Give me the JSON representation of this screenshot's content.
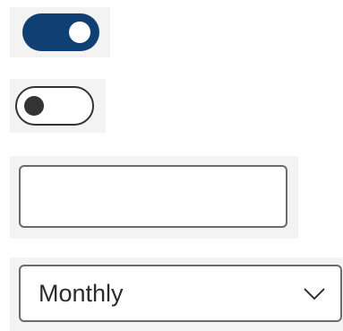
{
  "toggles": {
    "primary": {
      "state": "on"
    },
    "secondary": {
      "state": "off"
    }
  },
  "text_field": {
    "value": "",
    "placeholder": ""
  },
  "select": {
    "selected_label": "Monthly",
    "icon": "chevron-down-icon"
  },
  "colors": {
    "accent": "#0f3f73",
    "panel_background": "#f3f3f3",
    "border": "#6b6b6b"
  }
}
